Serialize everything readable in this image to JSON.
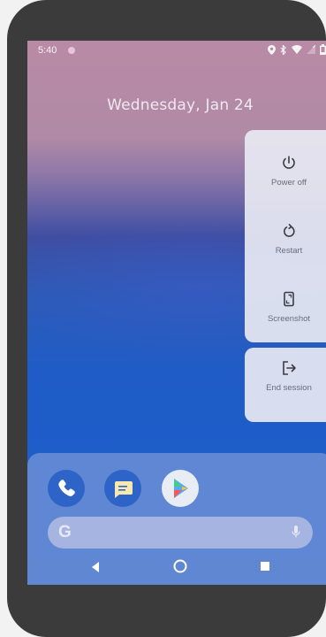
{
  "status_bar": {
    "time": "5:40",
    "icons": [
      "location-icon",
      "bluetooth-icon",
      "wifi-icon",
      "cell-signal-icon",
      "battery-icon"
    ]
  },
  "lock_screen": {
    "date": "Wednesday, Jan 24"
  },
  "power_menu": {
    "items": [
      {
        "label": "Power off",
        "icon": "power-icon"
      },
      {
        "label": "Restart",
        "icon": "restart-icon"
      },
      {
        "label": "Screenshot",
        "icon": "screenshot-icon"
      },
      {
        "label": "End session",
        "icon": "logout-icon"
      }
    ]
  },
  "dock": {
    "apps": [
      {
        "name": "Phone",
        "icon": "phone-icon"
      },
      {
        "name": "Messages",
        "icon": "messages-icon"
      },
      {
        "name": "Play Store",
        "icon": "play-store-icon"
      }
    ],
    "search": {
      "logo": "G",
      "mic_icon": "mic-icon"
    }
  },
  "colors": {
    "accent_blue": "#2e63c8",
    "menu_bg": "#e8e9f3",
    "menu_text": "#6a6c78",
    "device_frame": "#3b3b3b"
  }
}
